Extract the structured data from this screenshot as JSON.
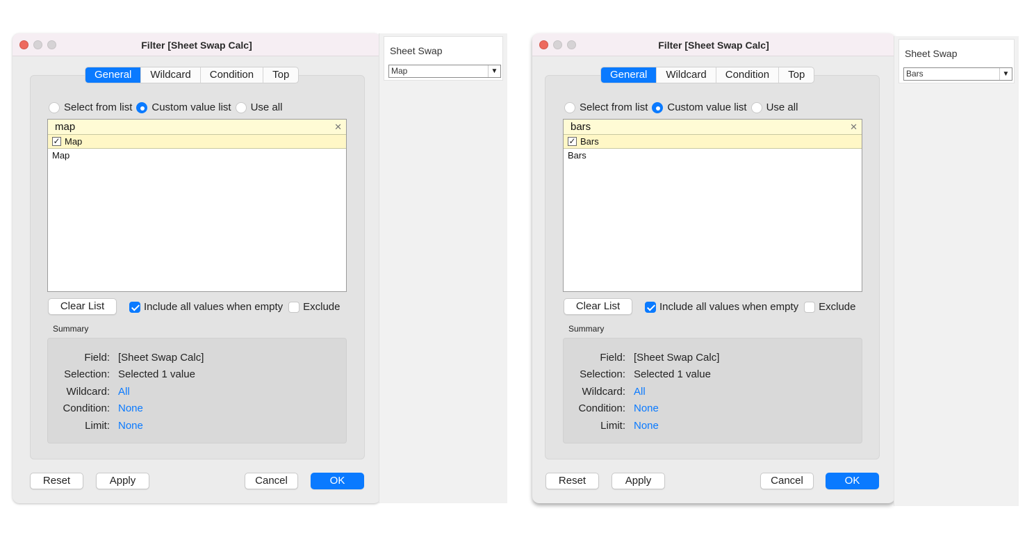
{
  "screens": [
    {
      "window_title": "Filter [Sheet Swap Calc]",
      "tabs": [
        "General",
        "Wildcard",
        "Condition",
        "Top"
      ],
      "active_tab": "General",
      "radio_options": [
        "Select from list",
        "Custom value list",
        "Use all"
      ],
      "selected_radio": "Custom value list",
      "search_value": "map",
      "checked_item": "Map",
      "values": [
        "Map"
      ],
      "clear_list_label": "Clear List",
      "include_all_label": "Include all values when empty",
      "exclude_label": "Exclude",
      "summary_label": "Summary",
      "summary": {
        "field_key": "Field:",
        "field_val": "[Sheet Swap Calc]",
        "selection_key": "Selection:",
        "selection_val": "Selected 1 value",
        "wildcard_key": "Wildcard:",
        "wildcard_val": "All",
        "condition_key": "Condition:",
        "condition_val": "None",
        "limit_key": "Limit:",
        "limit_val": "None"
      },
      "buttons": {
        "reset": "Reset",
        "apply": "Apply",
        "cancel": "Cancel",
        "ok": "OK"
      },
      "side_title": "Sheet Swap",
      "side_selected": "Map"
    },
    {
      "window_title": "Filter [Sheet Swap Calc]",
      "tabs": [
        "General",
        "Wildcard",
        "Condition",
        "Top"
      ],
      "active_tab": "General",
      "radio_options": [
        "Select from list",
        "Custom value list",
        "Use all"
      ],
      "selected_radio": "Custom value list",
      "search_value": "bars",
      "checked_item": "Bars",
      "values": [
        "Bars"
      ],
      "clear_list_label": "Clear List",
      "include_all_label": "Include all values when empty",
      "exclude_label": "Exclude",
      "summary_label": "Summary",
      "summary": {
        "field_key": "Field:",
        "field_val": "[Sheet Swap Calc]",
        "selection_key": "Selection:",
        "selection_val": "Selected 1 value",
        "wildcard_key": "Wildcard:",
        "wildcard_val": "All",
        "condition_key": "Condition:",
        "condition_val": "None",
        "limit_key": "Limit:",
        "limit_val": "None"
      },
      "buttons": {
        "reset": "Reset",
        "apply": "Apply",
        "cancel": "Cancel",
        "ok": "OK"
      },
      "side_title": "Sheet Swap",
      "side_selected": "Bars"
    }
  ],
  "colors": {
    "accent": "#0a7aff",
    "close_button": "#ed6a5e",
    "search_highlight": "#fffbd5"
  },
  "icons": {
    "clear": "close-icon",
    "dropdown": "chevron-down-icon",
    "check": "checkmark-icon"
  }
}
